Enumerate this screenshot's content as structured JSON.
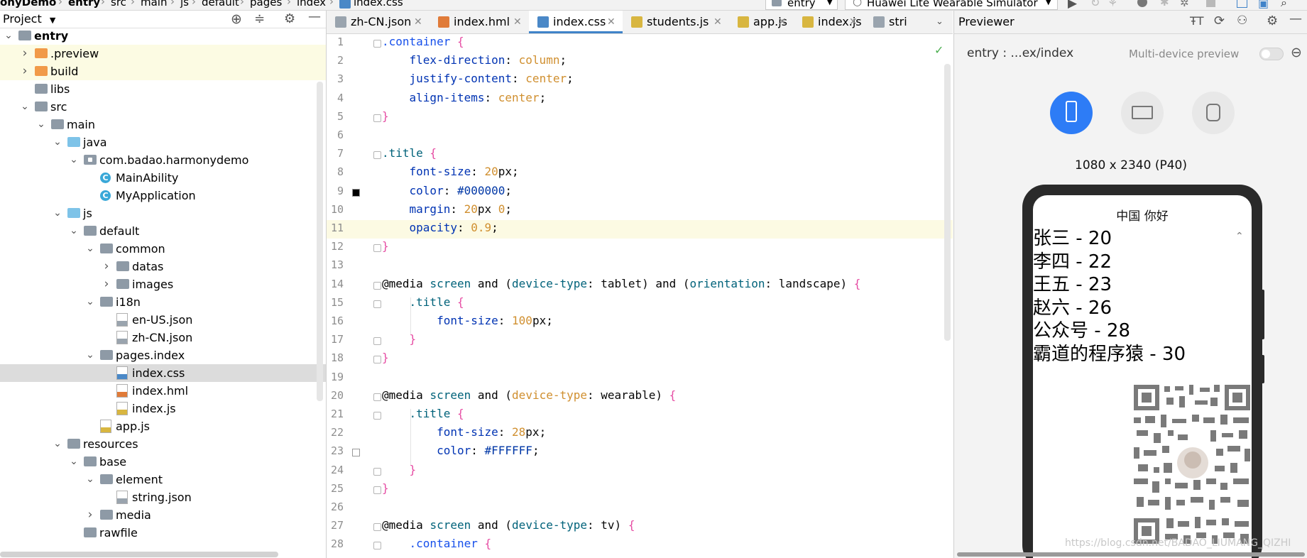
{
  "breadcrumb": [
    "onyDemo",
    "entry",
    "src",
    "main",
    "js",
    "default",
    "pages",
    "index",
    "index.css"
  ],
  "run_config": {
    "module": "entry",
    "device": "Huawei Lite Wearable Simulator"
  },
  "project_panel": {
    "title": "Project",
    "tree": [
      {
        "label": "entry",
        "depth": 0,
        "icon": "module-folder-icon",
        "expanded": true
      },
      {
        "label": ".preview",
        "depth": 1,
        "icon": "orange-folder-icon",
        "expanded": false
      },
      {
        "label": "build",
        "depth": 1,
        "icon": "orange-folder-icon",
        "expanded": false
      },
      {
        "label": "libs",
        "depth": 1,
        "icon": "folder-icon"
      },
      {
        "label": "src",
        "depth": 1,
        "icon": "folder-icon",
        "expanded": true
      },
      {
        "label": "main",
        "depth": 2,
        "icon": "folder-icon",
        "expanded": true
      },
      {
        "label": "java",
        "depth": 3,
        "icon": "blue-folder-icon",
        "expanded": true
      },
      {
        "label": "com.badao.harmonydemo",
        "depth": 4,
        "icon": "package-icon",
        "expanded": true
      },
      {
        "label": "MainAbility",
        "depth": 5,
        "icon": "class-icon"
      },
      {
        "label": "MyApplication",
        "depth": 5,
        "icon": "class-icon"
      },
      {
        "label": "js",
        "depth": 3,
        "icon": "blue-folder-icon",
        "expanded": true
      },
      {
        "label": "default",
        "depth": 4,
        "icon": "folder-icon",
        "expanded": true
      },
      {
        "label": "common",
        "depth": 5,
        "icon": "folder-icon",
        "expanded": true
      },
      {
        "label": "datas",
        "depth": 6,
        "icon": "folder-icon",
        "expanded": false
      },
      {
        "label": "images",
        "depth": 6,
        "icon": "folder-icon",
        "expanded": false
      },
      {
        "label": "i18n",
        "depth": 5,
        "icon": "folder-icon",
        "expanded": true
      },
      {
        "label": "en-US.json",
        "depth": 6,
        "icon": "json-file-icon"
      },
      {
        "label": "zh-CN.json",
        "depth": 6,
        "icon": "json-file-icon"
      },
      {
        "label": "pages.index",
        "depth": 5,
        "icon": "folder-icon",
        "expanded": true
      },
      {
        "label": "index.css",
        "depth": 6,
        "icon": "css-file-icon",
        "selected": true
      },
      {
        "label": "index.hml",
        "depth": 6,
        "icon": "hml-file-icon"
      },
      {
        "label": "index.js",
        "depth": 6,
        "icon": "js-file-icon"
      },
      {
        "label": "app.js",
        "depth": 5,
        "icon": "js-file-icon"
      },
      {
        "label": "resources",
        "depth": 3,
        "icon": "resources-folder-icon",
        "expanded": true
      },
      {
        "label": "base",
        "depth": 4,
        "icon": "folder-icon",
        "expanded": true
      },
      {
        "label": "element",
        "depth": 5,
        "icon": "folder-icon",
        "expanded": true
      },
      {
        "label": "string.json",
        "depth": 6,
        "icon": "json-file-icon"
      },
      {
        "label": "media",
        "depth": 5,
        "icon": "folder-icon",
        "expanded": false
      },
      {
        "label": "rawfile",
        "depth": 4,
        "icon": "folder-icon"
      }
    ]
  },
  "editor": {
    "tabs": [
      {
        "label": "zh-CN.json",
        "icon": "json-file-icon"
      },
      {
        "label": "index.hml",
        "icon": "hml-file-icon"
      },
      {
        "label": "index.css",
        "icon": "css-file-icon",
        "active": true
      },
      {
        "label": "students.js",
        "icon": "js-file-icon"
      },
      {
        "label": "app.js",
        "icon": "js-file-icon"
      },
      {
        "label": "index.js",
        "icon": "js-file-icon"
      },
      {
        "label": "stri",
        "icon": "json-file-icon"
      }
    ],
    "current_line": 11,
    "lines": [
      [
        [
          ".container",
          "sel-k"
        ],
        [
          " {",
          "br"
        ]
      ],
      [
        [
          "    ",
          "plain"
        ],
        [
          "flex-direction",
          "prop"
        ],
        [
          ": ",
          "plain"
        ],
        [
          "column",
          "val"
        ],
        [
          ";",
          "plain"
        ]
      ],
      [
        [
          "    ",
          "plain"
        ],
        [
          "justify-content",
          "prop"
        ],
        [
          ": ",
          "plain"
        ],
        [
          "center",
          "val"
        ],
        [
          ";",
          "plain"
        ]
      ],
      [
        [
          "    ",
          "plain"
        ],
        [
          "align-items",
          "prop"
        ],
        [
          ": ",
          "plain"
        ],
        [
          "center",
          "val"
        ],
        [
          ";",
          "plain"
        ]
      ],
      [
        [
          "}",
          "br"
        ]
      ],
      [],
      [
        [
          ".title",
          "sel-t"
        ],
        [
          " {",
          "br"
        ]
      ],
      [
        [
          "    ",
          "plain"
        ],
        [
          "font-size",
          "prop"
        ],
        [
          ": ",
          "plain"
        ],
        [
          "20",
          "num"
        ],
        [
          "px;",
          "plain"
        ]
      ],
      [
        [
          "    ",
          "plain"
        ],
        [
          "color",
          "prop"
        ],
        [
          ": ",
          "plain"
        ],
        [
          "#000000",
          "hex"
        ],
        [
          ";",
          "plain"
        ]
      ],
      [
        [
          "    ",
          "plain"
        ],
        [
          "margin",
          "prop"
        ],
        [
          ": ",
          "plain"
        ],
        [
          "20",
          "num"
        ],
        [
          "px ",
          "plain"
        ],
        [
          "0",
          "num"
        ],
        [
          ";",
          "plain"
        ]
      ],
      [
        [
          "    ",
          "plain"
        ],
        [
          "opacity",
          "prop"
        ],
        [
          ": ",
          "plain"
        ],
        [
          "0.9",
          "num"
        ],
        [
          ";",
          "plain"
        ]
      ],
      [
        [
          "}",
          "br"
        ]
      ],
      [],
      [
        [
          "@media ",
          "media"
        ],
        [
          "screen",
          "sel-t"
        ],
        [
          " and ",
          "media"
        ],
        [
          "(",
          "plain"
        ],
        [
          "device-type",
          "sel-t"
        ],
        [
          ": tablet",
          "plain"
        ],
        [
          ")",
          "plain"
        ],
        [
          " and ",
          "media"
        ],
        [
          "(",
          "plain"
        ],
        [
          "orientation",
          "sel-t"
        ],
        [
          ": landscape",
          "plain"
        ],
        [
          ")",
          "plain"
        ],
        [
          " {",
          "br"
        ]
      ],
      [
        [
          "    ",
          "plain"
        ],
        [
          ".title",
          "sel-t"
        ],
        [
          " {",
          "br"
        ]
      ],
      [
        [
          "        ",
          "plain"
        ],
        [
          "font-size",
          "prop"
        ],
        [
          ": ",
          "plain"
        ],
        [
          "100",
          "num"
        ],
        [
          "px;",
          "plain"
        ]
      ],
      [
        [
          "    ",
          "plain"
        ],
        [
          "}",
          "br"
        ]
      ],
      [
        [
          "}",
          "br"
        ]
      ],
      [],
      [
        [
          "@media ",
          "media"
        ],
        [
          "screen",
          "sel-t"
        ],
        [
          " and ",
          "media"
        ],
        [
          "(",
          "plain"
        ],
        [
          "device-type",
          "val"
        ],
        [
          ": wearable",
          "plain"
        ],
        [
          ")",
          "plain"
        ],
        [
          " {",
          "br"
        ]
      ],
      [
        [
          "    ",
          "plain"
        ],
        [
          ".title",
          "sel-t"
        ],
        [
          " {",
          "br"
        ]
      ],
      [
        [
          "        ",
          "plain"
        ],
        [
          "font-size",
          "prop"
        ],
        [
          ": ",
          "plain"
        ],
        [
          "28",
          "num"
        ],
        [
          "px;",
          "plain"
        ]
      ],
      [
        [
          "        ",
          "plain"
        ],
        [
          "color",
          "prop"
        ],
        [
          ": ",
          "plain"
        ],
        [
          "#FFFFFF",
          "hex"
        ],
        [
          ";",
          "plain"
        ]
      ],
      [
        [
          "    ",
          "plain"
        ],
        [
          "}",
          "br"
        ]
      ],
      [
        [
          "}",
          "br"
        ]
      ],
      [],
      [
        [
          "@media ",
          "media"
        ],
        [
          "screen",
          "sel-t"
        ],
        [
          " and ",
          "media"
        ],
        [
          "(",
          "plain"
        ],
        [
          "device-type",
          "sel-t"
        ],
        [
          ": tv",
          "plain"
        ],
        [
          ")",
          "plain"
        ],
        [
          " {",
          "br"
        ]
      ],
      [
        [
          "    ",
          "plain"
        ],
        [
          ".container",
          "sel-k"
        ],
        [
          " {",
          "br"
        ]
      ]
    ],
    "color_swatches": {
      "9": "#000000",
      "23": "#FFFFFF"
    }
  },
  "previewer": {
    "title": "Previewer",
    "path": "entry : ...ex/index",
    "multi_device_label": "Multi-device preview",
    "resolution": "1080 x 2340 (P40)",
    "devices": [
      "phone-icon",
      "tv-icon",
      "watch-icon"
    ],
    "screen": {
      "title": "中国 你好",
      "students": [
        "张三 - 20",
        "李四 - 22",
        "王五 - 23",
        "赵六 - 26",
        "公众号 - 28",
        "霸道的程序猿 - 30"
      ]
    }
  },
  "watermark": "https://blog.csdn.net/BADAO_LIUMANG_QIZHI",
  "colors": {
    "accent": "#2d7cf6",
    "tab_underline": "#4083c9",
    "selected_row": "#dcdcdc",
    "highlight_row": "#fcfbe3",
    "current_line": "#fcfae3"
  }
}
